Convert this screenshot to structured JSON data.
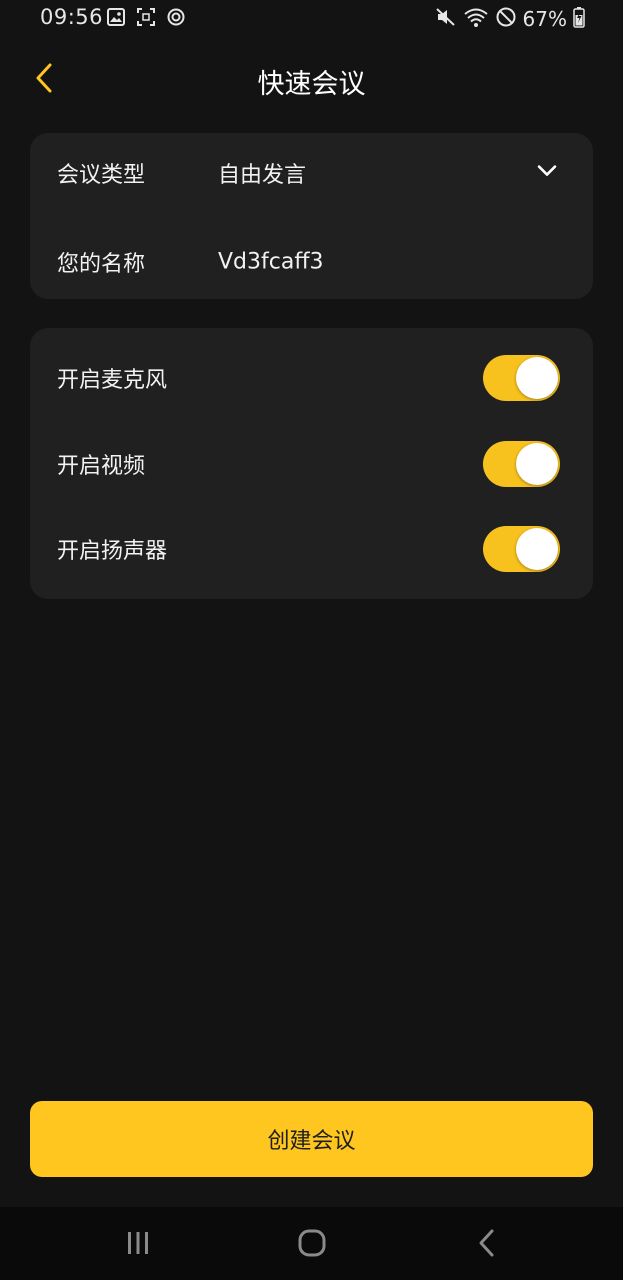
{
  "status_bar": {
    "time": "09:56",
    "battery_percent": "67%",
    "left_icons": [
      "image-icon",
      "screenshot-icon",
      "sync-icon"
    ],
    "right_icons": [
      "mute-icon",
      "wifi-icon",
      "do-not-disturb-icon",
      "battery-icon"
    ]
  },
  "header": {
    "title": "快速会议",
    "back_icon": "chevron-left-icon"
  },
  "meeting_info": {
    "type_label": "会议类型",
    "type_value": "自由发言",
    "name_label": "您的名称",
    "name_value": "Vd3fcaff3"
  },
  "settings": [
    {
      "label": "开启麦克风",
      "enabled": true
    },
    {
      "label": "开启视频",
      "enabled": true
    },
    {
      "label": "开启扬声器",
      "enabled": true
    }
  ],
  "create_button": {
    "label": "创建会议"
  },
  "nav_bar": {
    "icons": [
      "recents-icon",
      "home-icon",
      "back-icon"
    ]
  },
  "colors": {
    "accent": "#fec61f",
    "toggle_on": "#f8c21e",
    "background": "#131313",
    "card": "#202020"
  }
}
